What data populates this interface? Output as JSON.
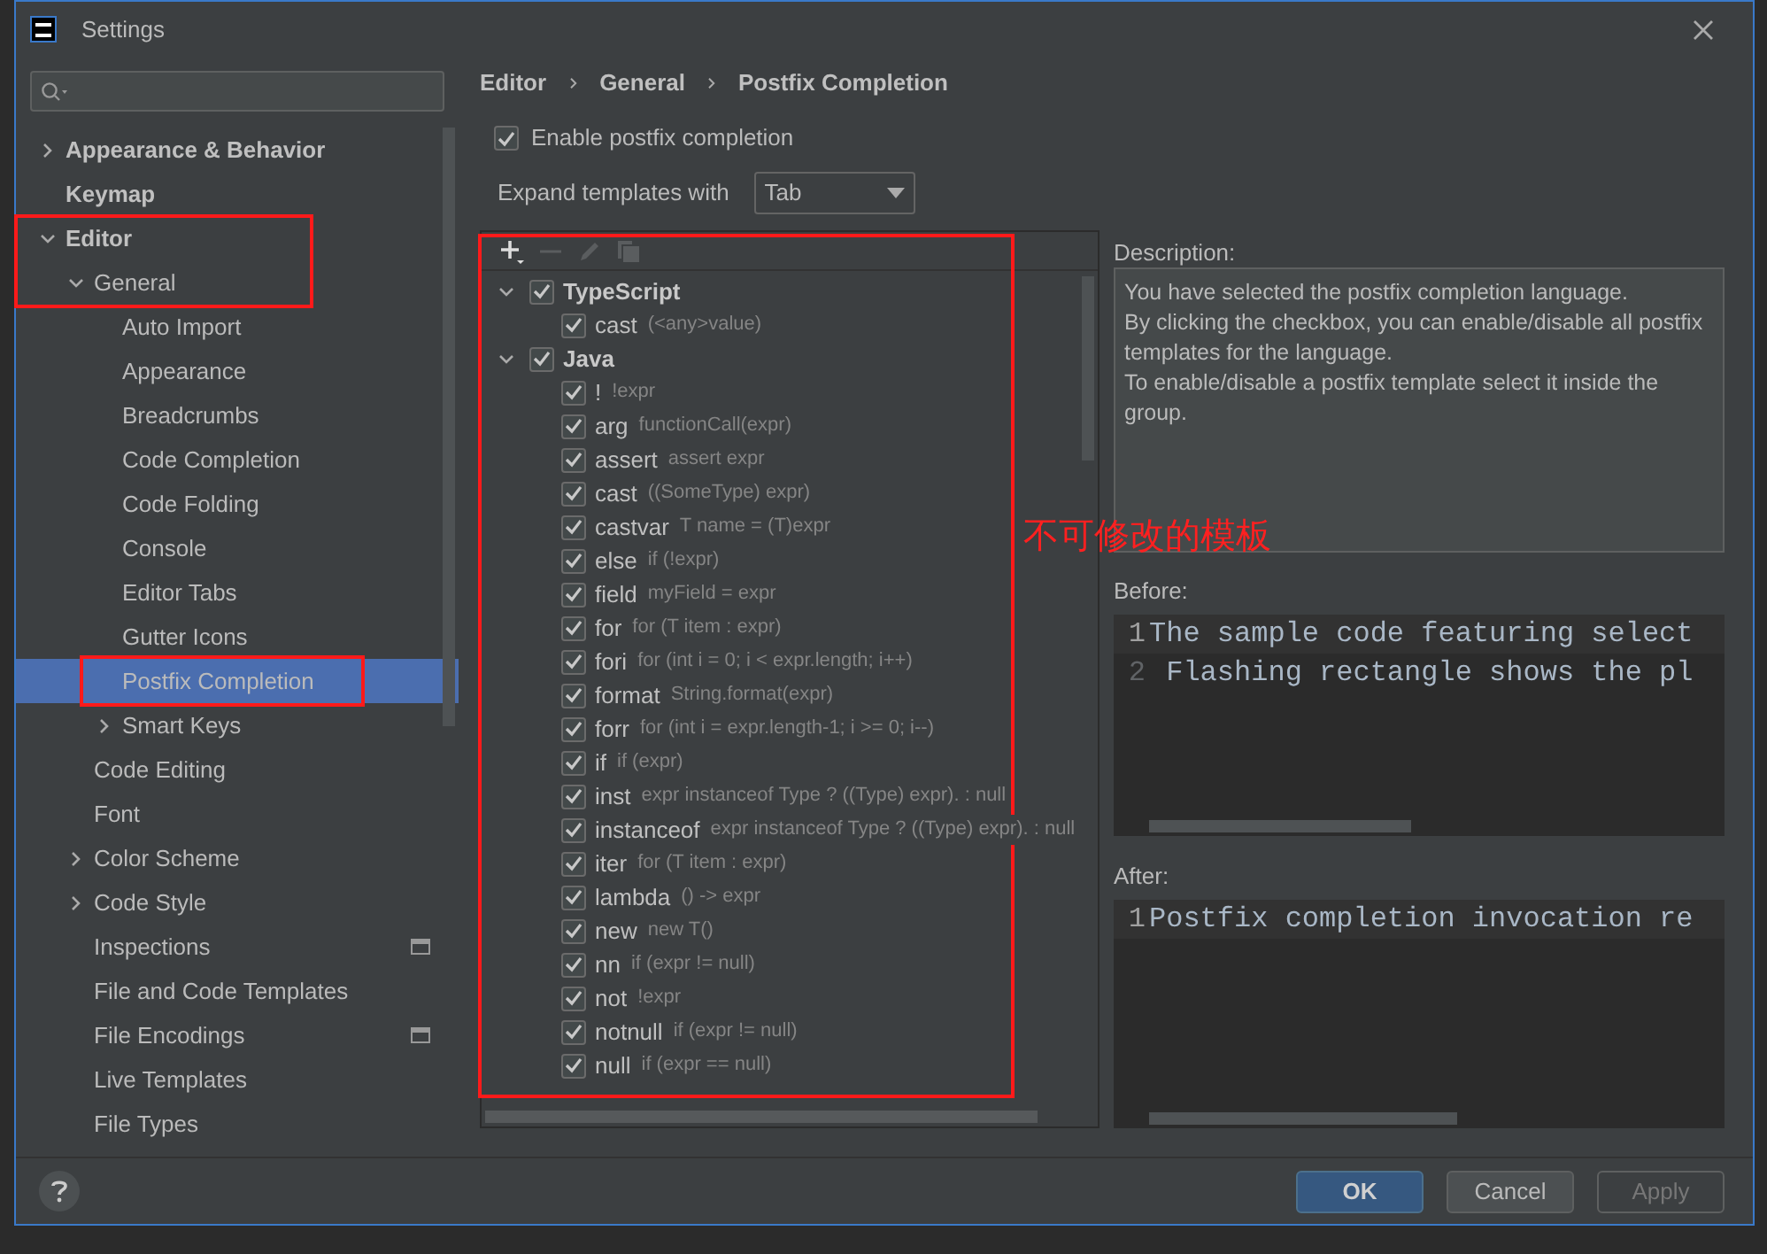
{
  "window": {
    "title": "Settings"
  },
  "sidebar": {
    "items": [
      {
        "label": "Appearance & Behavior",
        "expanded": false
      },
      {
        "label": "Keymap"
      },
      {
        "label": "Editor",
        "expanded": true,
        "children": [
          {
            "label": "General",
            "expanded": true,
            "children": [
              {
                "label": "Auto Import",
                "selected": false
              },
              {
                "label": "Appearance",
                "selected": false
              },
              {
                "label": "Breadcrumbs",
                "selected": false
              },
              {
                "label": "Code Completion",
                "selected": false
              },
              {
                "label": "Code Folding",
                "selected": false
              },
              {
                "label": "Console",
                "selected": false
              },
              {
                "label": "Editor Tabs",
                "selected": false
              },
              {
                "label": "Gutter Icons",
                "selected": false
              },
              {
                "label": "Postfix Completion",
                "selected": true
              },
              {
                "label": "Smart Keys",
                "selected": false,
                "expanded": false
              }
            ]
          },
          {
            "label": "Code Editing",
            "selected": false
          },
          {
            "label": "Font",
            "selected": false
          },
          {
            "label": "Color Scheme",
            "selected": false,
            "expanded": false
          },
          {
            "label": "Code Style",
            "selected": false,
            "expanded": false
          },
          {
            "label": "Inspections",
            "selected": false,
            "project_scope": true
          },
          {
            "label": "File and Code Templates",
            "selected": false
          },
          {
            "label": "File Encodings",
            "selected": false,
            "project_scope": true
          },
          {
            "label": "Live Templates",
            "selected": false
          },
          {
            "label": "File Types",
            "selected": false
          }
        ]
      }
    ]
  },
  "breadcrumb": [
    "Editor",
    "General",
    "Postfix Completion"
  ],
  "enable_checkbox": {
    "label": "Enable postfix completion",
    "checked": true
  },
  "expand_with": {
    "label": "Expand templates with",
    "value": "Tab"
  },
  "templates": [
    {
      "name": "TypeScript",
      "checked": true,
      "expanded": true,
      "children": [
        {
          "key": "cast",
          "example": "(<any>value)",
          "checked": true
        }
      ]
    },
    {
      "name": "Java",
      "checked": true,
      "expanded": true,
      "children": [
        {
          "key": "!",
          "example": "!expr",
          "checked": true
        },
        {
          "key": "arg",
          "example": "functionCall(expr)",
          "checked": true
        },
        {
          "key": "assert",
          "example": "assert expr",
          "checked": true
        },
        {
          "key": "cast",
          "example": "((SomeType) expr)",
          "checked": true
        },
        {
          "key": "castvar",
          "example": "T name = (T)expr",
          "checked": true
        },
        {
          "key": "else",
          "example": "if (!expr)",
          "checked": true
        },
        {
          "key": "field",
          "example": "myField = expr",
          "checked": true
        },
        {
          "key": "for",
          "example": "for (T item : expr)",
          "checked": true
        },
        {
          "key": "fori",
          "example": "for (int i = 0; i < expr.length; i++)",
          "checked": true
        },
        {
          "key": "format",
          "example": "String.format(expr)",
          "checked": true
        },
        {
          "key": "forr",
          "example": "for (int i = expr.length-1; i >= 0; i--)",
          "checked": true
        },
        {
          "key": "if",
          "example": "if (expr)",
          "checked": true
        },
        {
          "key": "inst",
          "example": "expr instanceof Type ? ((Type) expr). : null",
          "checked": true
        },
        {
          "key": "instanceof",
          "example": "expr instanceof Type ? ((Type) expr). : null",
          "checked": true
        },
        {
          "key": "iter",
          "example": "for (T item : expr)",
          "checked": true
        },
        {
          "key": "lambda",
          "example": "() -> expr",
          "checked": true
        },
        {
          "key": "new",
          "example": "new T()",
          "checked": true
        },
        {
          "key": "nn",
          "example": "if (expr != null)",
          "checked": true
        },
        {
          "key": "not",
          "example": "!expr",
          "checked": true
        },
        {
          "key": "notnull",
          "example": "if (expr != null)",
          "checked": true
        },
        {
          "key": "null",
          "example": "if (expr == null)",
          "checked": true
        }
      ]
    }
  ],
  "description": {
    "label": "Description:",
    "paragraphs": [
      "You have selected the postfix completion language.",
      "By clicking the checkbox, you can enable/disable all postfix templates for the language.",
      "To enable/disable a postfix template select it inside the group."
    ]
  },
  "before": {
    "label": "Before:",
    "lines": [
      {
        "number": "1",
        "text": "The sample code featuring select"
      },
      {
        "number": "2",
        "text": " Flashing rectangle shows the pl"
      }
    ]
  },
  "after": {
    "label": "After:",
    "lines": [
      {
        "number": "1",
        "text": "Postfix completion invocation re"
      }
    ]
  },
  "buttons": [
    {
      "label": "OK",
      "kind": "default"
    },
    {
      "label": "Cancel",
      "kind": "normal"
    },
    {
      "label": "Apply",
      "kind": "disabled"
    }
  ],
  "annotation_note": "不可修改的模板"
}
